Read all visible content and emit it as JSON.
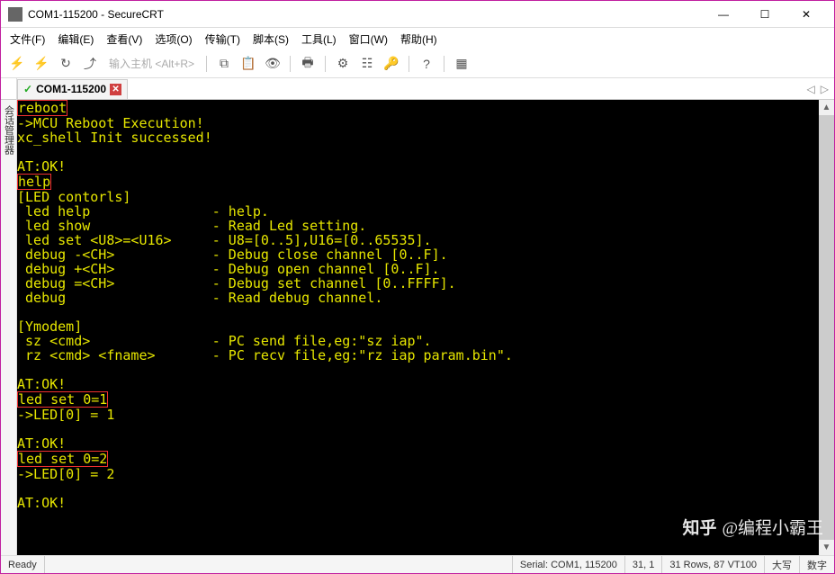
{
  "window": {
    "title": "COM1-115200 - SecureCRT",
    "min": "—",
    "max": "☐",
    "close": "✕"
  },
  "menu": {
    "file": "文件(F)",
    "edit": "编辑(E)",
    "view": "查看(V)",
    "options": "选项(O)",
    "transfer": "传输(T)",
    "script": "脚本(S)",
    "tools": "工具(L)",
    "window": "窗口(W)",
    "help": "帮助(H)"
  },
  "toolbar": {
    "host_hint": "输入主机 <Alt+R>"
  },
  "tab": {
    "label": "COM1-115200"
  },
  "sidebar": {
    "label": "会话管理器"
  },
  "terminal": {
    "cmd_reboot": "reboot",
    "l2": "->MCU Reboot Execution!",
    "l3": "xc_shell Init successed!",
    "l5": "AT:OK!",
    "cmd_help": "help",
    "l7": "[LED contorls]",
    "l8": " led help               - help.",
    "l9": " led show               - Read Led setting.",
    "l10": " led set <U8>=<U16>     - U8=[0..5],U16=[0..65535].",
    "l11": " debug -<CH>            - Debug close channel [0..F].",
    "l12": " debug +<CH>            - Debug open channel [0..F].",
    "l13": " debug =<CH>            - Debug set channel [0..FFFF].",
    "l14": " debug                  - Read debug channel.",
    "l16": "[Ymodem]",
    "l17": " sz <cmd>               - PC send file,eg:\"sz iap\".",
    "l18": " rz <cmd> <fname>       - PC recv file,eg:\"rz iap param.bin\".",
    "l20": "AT:OK!",
    "cmd_led1": "led set 0=1",
    "l22": "->LED[0] = 1",
    "l24": "AT:OK!",
    "cmd_led2": "led set 0=2",
    "l26": "->LED[0] = 2",
    "l28": "AT:OK!"
  },
  "watermark_zhihu": "知乎",
  "watermark_user": "@编程小霸王",
  "status": {
    "ready": "Ready",
    "serial": "Serial: COM1, 115200",
    "pos": "31,   1",
    "size": "31 Rows, 87 VT100",
    "caps": "大写",
    "num": "数字"
  }
}
